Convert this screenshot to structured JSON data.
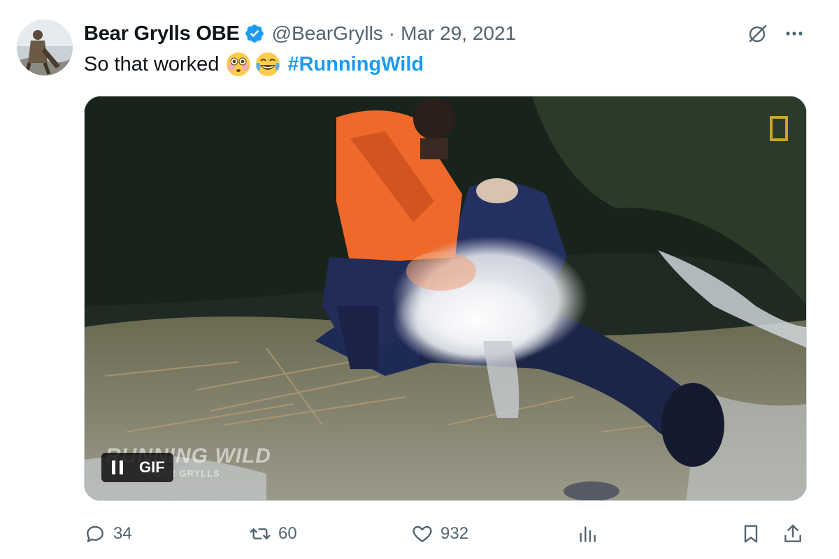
{
  "author": {
    "display_name": "Bear Grylls OBE",
    "handle": "@BearGrylls",
    "separator": "·",
    "date": "Mar 29, 2021",
    "verified": true,
    "verified_icon": "verified-badge-icon"
  },
  "tweet": {
    "text": "So that worked",
    "emojis": [
      "flushed-face-emoji",
      "tears-of-joy-emoji"
    ],
    "hashtag": "#RunningWild"
  },
  "media": {
    "type_label": "GIF",
    "watermark_title": "RUNNING WILD",
    "watermark_sub": "BEAR GRYLLS",
    "pause_icon": "pause-icon"
  },
  "actions": {
    "replies": "34",
    "retweets": "60",
    "likes": "932"
  },
  "colors": {
    "accent": "#1d9bf0",
    "text_secondary": "#536471",
    "text_primary": "#0f1419"
  }
}
